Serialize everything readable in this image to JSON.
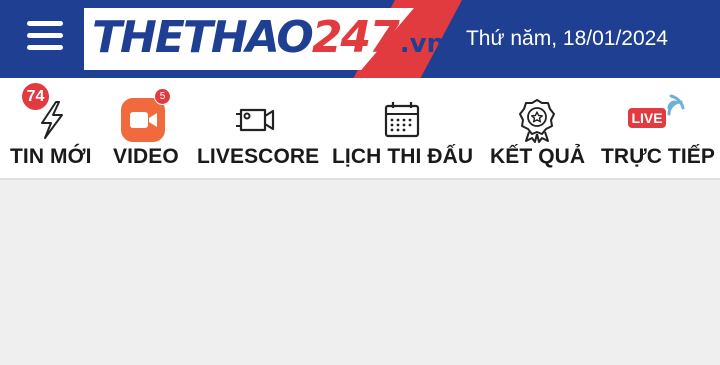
{
  "header": {
    "logo_main": "THETHAO",
    "logo_num": "247",
    "logo_suffix": ".vn",
    "date": "Thứ năm, 18/01/2024",
    "colors": {
      "brand_blue": "#1f3f93",
      "brand_red": "#e23b3f"
    }
  },
  "nav": {
    "items": [
      {
        "label": "TIN MỚI",
        "icon": "lightning-icon",
        "badge": "74"
      },
      {
        "label": "VIDEO",
        "icon": "video-camera-icon",
        "badge": "5"
      },
      {
        "label": "LIVESCORE",
        "icon": "livescore-camera-icon"
      },
      {
        "label": "LỊCH THI ĐẤU",
        "icon": "calendar-icon"
      },
      {
        "label": "KẾT QUẢ",
        "icon": "award-medal-icon"
      },
      {
        "label": "TRỰC TIẾP",
        "icon": "live-broadcast-icon",
        "icon_text": "LIVE"
      }
    ]
  }
}
